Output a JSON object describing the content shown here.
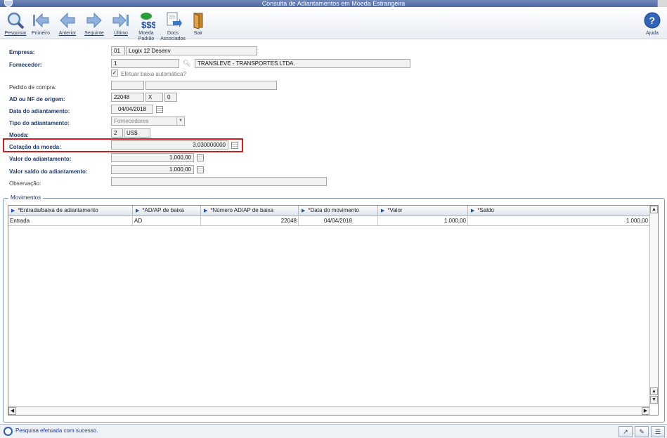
{
  "window": {
    "title": "Consulta de Adiantamentos em Moeda Estrangeira"
  },
  "toolbar": {
    "pesquisar": "Pesquisar",
    "primeiro": "Primeiro",
    "anterior": "Anterior",
    "seguinte": "Seguinte",
    "ultimo": "Último",
    "moeda_padrao_1": "Moeda",
    "moeda_padrao_2": "Padrão",
    "docs_1": "Docs",
    "docs_2": "Associados",
    "sair": "Sair",
    "ajuda": "Ajuda"
  },
  "form": {
    "empresa": {
      "label": "Empresa:",
      "code": "01",
      "name": "Logix 12 Desenv"
    },
    "fornecedor": {
      "label": "Fornecedor:",
      "code": "1",
      "name": "TRANSLEVE - TRANSPORTES LTDA."
    },
    "baixa_automatica": {
      "label": "Efetuar baixa automática?",
      "checked": true
    },
    "pedido_compra": {
      "label": "Pedido de compra:",
      "value1": "",
      "value2": ""
    },
    "ad_nf_origem": {
      "label": "AD ou NF de origem:",
      "number": "22048",
      "type": "X",
      "seq": "0"
    },
    "data_adiantamento": {
      "label": "Data do adiantamento:",
      "value": "04/04/2018"
    },
    "tipo_adiantamento": {
      "label": "Tipo do adiantamento:",
      "value": "Fornecedores"
    },
    "moeda": {
      "label": "Moeda:",
      "code": "2",
      "symbol": "US$"
    },
    "cotacao_moeda": {
      "label": "Cotação da moeda:",
      "value": "3,030000000"
    },
    "valor_adiantamento": {
      "label": "Valor do adiantamento:",
      "value": "1.000,00"
    },
    "valor_saldo": {
      "label": "Valor saldo do adiantamento:",
      "value": "1.000,00"
    },
    "observacao": {
      "label": "Observação:",
      "value": ""
    }
  },
  "movimentos": {
    "title": "Movimentos",
    "columns": [
      "*Entrada/baixa de adiantamento",
      "*AD/AP de baixa",
      "*Número AD/AP de baixa",
      "*Data do movimento",
      "*Valor",
      "*Saldo"
    ],
    "rows": [
      [
        "Entrada",
        "AD",
        "22048",
        "04/04/2018",
        "1.000,00",
        "1.000,00"
      ]
    ]
  },
  "status": {
    "message": "Pesquisa efetuada com sucesso."
  },
  "colors": {
    "highlight": "#d21e1e",
    "status_text": "#1537a8",
    "label": "#1d3a6e"
  },
  "icons": [
    "search-icon",
    "first-arrow-icon",
    "previous-arrow-icon",
    "next-arrow-icon",
    "last-arrow-icon",
    "currency-icon",
    "documents-icon",
    "exit-door-icon",
    "help-icon"
  ]
}
